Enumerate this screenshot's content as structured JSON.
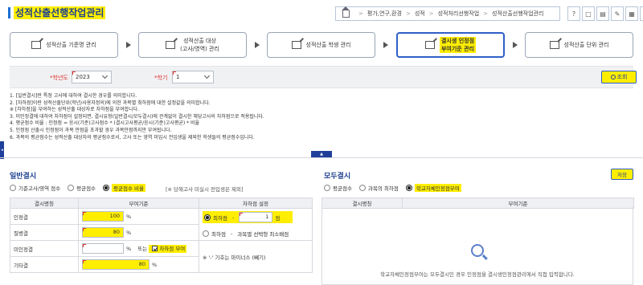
{
  "header": {
    "title": "성적산출선행작업관리",
    "breadcrumb": [
      "평가,연구,환경",
      "성적",
      "성적처리선행작업",
      "성적산출선행작업관리"
    ],
    "icons": [
      "help-icon",
      "comment-icon",
      "document-icon",
      "tools-icon",
      "calendar-icon",
      "star-icon"
    ],
    "icon_glyphs": [
      "?",
      "□",
      "▤",
      "✎",
      "▦",
      "☆"
    ]
  },
  "steps": [
    {
      "label": "성적산출 기준명 관리",
      "active": false
    },
    {
      "label": "성적산출 대상\n(고사/영역) 관리",
      "active": false
    },
    {
      "label": "성적산출 학생 관리",
      "active": false
    },
    {
      "label": "결시생 인정점\n부여기준 관리",
      "active": true
    },
    {
      "label": "성적산출 단위 관리",
      "active": false
    }
  ],
  "search": {
    "year_label": "*학년도",
    "year_value": "2023",
    "term_label": "*학기",
    "term_value": "1",
    "search_button": "조회",
    "search_icon": "magnifier-icon"
  },
  "notes": [
    "1. [일반결시]란 특정 고사에 대하여 결시한 경우를 의미합니다.",
    "2. [차하점]이란 성적산출단위(학년/사용자정의)에 의한 과목별 최하점에 대한 설정값을 의미합니다.",
    "※ [차하점]을 부여하는 성적산출 대상자로 차하점을 부여합니다.",
    "3. 미인정결에 대하여 차하점이 설정되면, 결시유형(일반결시/모두결시)에 관계없이 결시한 해당고사의 차하점으로 적용됩니다.",
    "4. 평균점수 비율 : 인정점 = 응시(기준)고사점수 * (결시고사평균/응시(기준)고사평균) * 비율",
    "5. 인정점 산출시 인정점이 과목 만점을 초과할 경우 과목만점까지만 부여됩니다.",
    "6. 과목의 평균점수는 성적산출 대상자의 평균점수로서, 고사 또는 영역 미입시 전입생을 제외한 학생들의 평균점수입니다."
  ],
  "general": {
    "title": "일반결시",
    "options": [
      "기준고사/영역 점수",
      "평균점수",
      "평균점수 비율"
    ],
    "selected_option": 2,
    "note": "[※ 당해고사 미실시 전입생은 제외]",
    "columns": [
      "결시명칭",
      "부여기준",
      "차하점 설정"
    ],
    "rows": [
      {
        "name": "인정결",
        "value": "100",
        "unit": "%"
      },
      {
        "name": "질병결",
        "value": "80",
        "unit": "%"
      },
      {
        "name": "미인정결",
        "value": "",
        "unit": "%",
        "or_text": "또는",
        "checkbox_label": "차하점 부여",
        "checked": true
      },
      {
        "name": "기타결",
        "value": "80",
        "unit": "%"
      }
    ],
    "lowpoint": {
      "option1_label": "최하점",
      "dash": "-",
      "option1_value": "1",
      "option1_unit": "점",
      "option2_label": "최하점",
      "option2_text": "과목별 선택형 최소배점",
      "selected": 0
    },
    "footnote": "※ '-' 기호는 마이너스 (빼기)"
  },
  "all": {
    "title": "모두결시",
    "save_button": "저장",
    "options": [
      "평균점수",
      "과목의 최하점",
      "학교자체인정점부여"
    ],
    "selected_option": 2,
    "columns": [
      "결시명칭",
      "부여기준"
    ],
    "empty_message": "학교자체인정점부여는 모두결시인 경우 인정점을 결시생인정점관리에서 직접 입력합니다.",
    "empty_icon": "magnifier-icon"
  },
  "colors": {
    "highlight": "#ffee00",
    "accent": "#1c3f8f",
    "required": "#e0322d"
  }
}
